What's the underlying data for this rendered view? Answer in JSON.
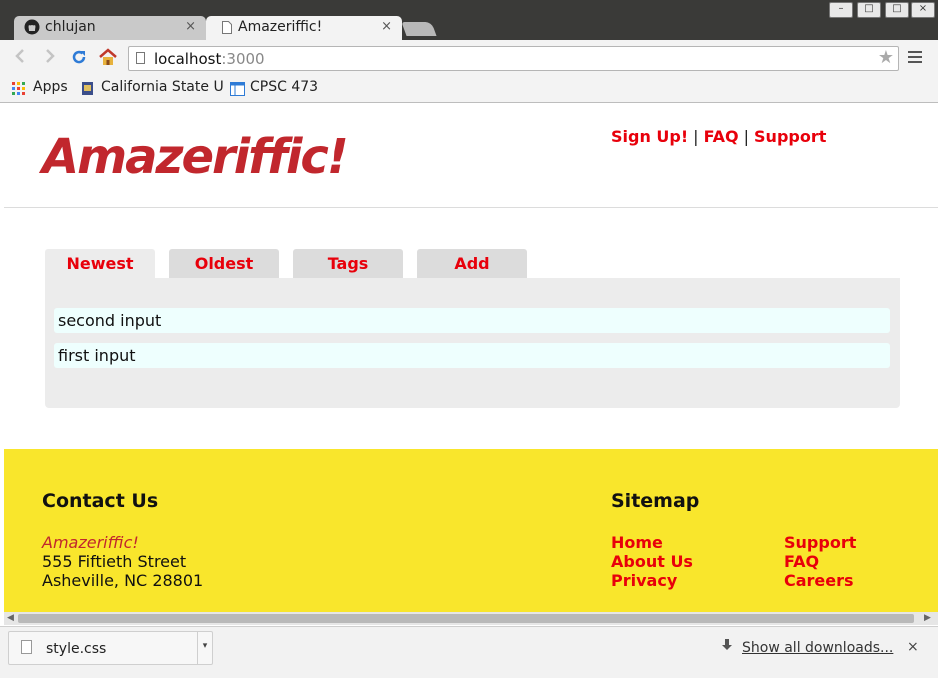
{
  "browser": {
    "tabs": [
      {
        "label": "chlujan",
        "close": "×",
        "icon": "github-icon"
      },
      {
        "label": "Amazeriffic!",
        "close": "×",
        "icon": "page-icon"
      }
    ],
    "window_buttons": [
      "–",
      "□",
      "×"
    ],
    "address": {
      "host": "localhost",
      "port": ":3000"
    },
    "bookmarks": [
      {
        "label": "Apps",
        "icon": "apps-grid-icon"
      },
      {
        "label": "California State U",
        "icon": "university-icon"
      },
      {
        "label": "CPSC 473",
        "icon": "window-icon"
      }
    ]
  },
  "page": {
    "brand": "Amazeriffic!",
    "nav": {
      "signup": "Sign Up!",
      "faq": "FAQ",
      "support": "Support",
      "separator": "|"
    },
    "tabs": [
      "Newest",
      "Oldest",
      "Tags",
      "Add"
    ],
    "active_tab": "Newest",
    "items": [
      "second input",
      "first input"
    ]
  },
  "footer": {
    "contact": {
      "heading": "Contact Us",
      "brand": "Amazeriffic!",
      "street": "555 Fiftieth Street",
      "city": "Asheville, NC 28801"
    },
    "sitemap": {
      "heading": "Sitemap",
      "col1": [
        "Home",
        "About Us",
        "Privacy"
      ],
      "col2": [
        "Support",
        "FAQ",
        "Careers"
      ]
    }
  },
  "downloads": {
    "file": "style.css",
    "show_all": "Show all downloads...",
    "close": "×"
  }
}
